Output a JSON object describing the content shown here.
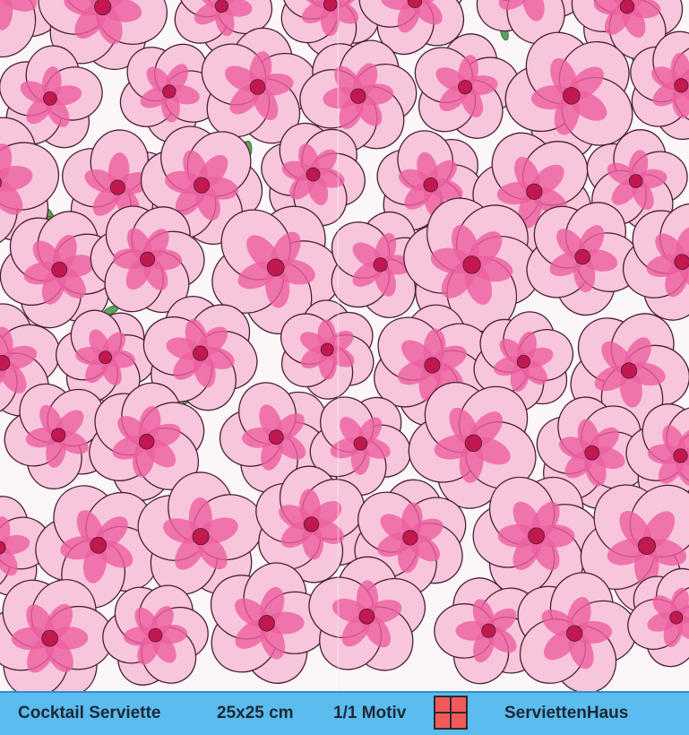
{
  "product": {
    "type_label": "Cocktail Serviette",
    "size_label": "25x25 cm",
    "motif_label": "1/1 Motiv",
    "brand_label": "ServiettenHaus"
  },
  "pattern": {
    "description_icon": "pink-blossom-pattern",
    "colors": {
      "background": "#fbf6f8",
      "petal_light": "#f7c6dc",
      "petal_mid": "#f29bc2",
      "petal_deep": "#ee5fa0",
      "center": "#c0184f",
      "outline": "#4a2030",
      "leaf": "#5fa25a"
    }
  },
  "caption_bar": {
    "color": "#5bbcf0",
    "motif_icon": "red-four-square-icon"
  }
}
